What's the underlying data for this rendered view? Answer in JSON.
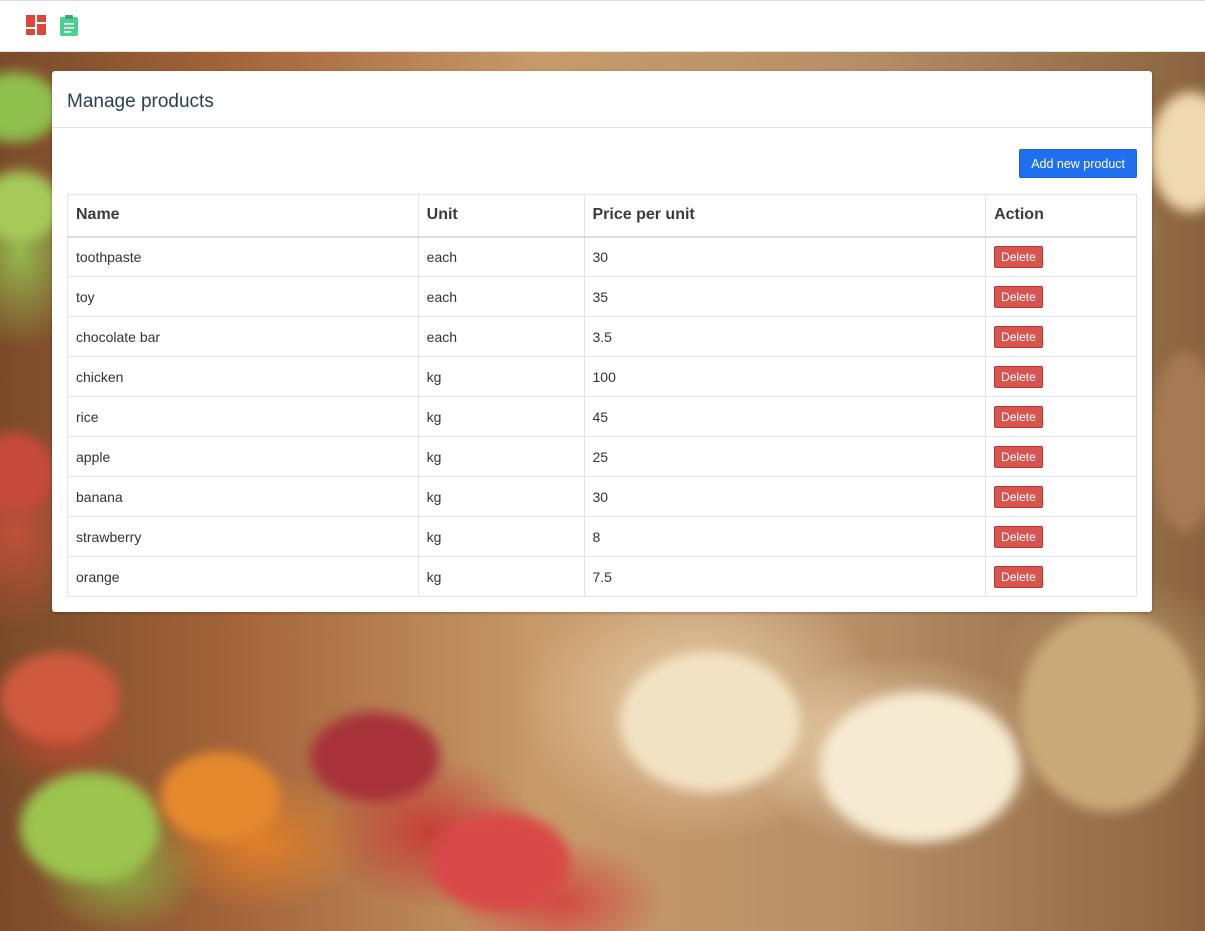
{
  "navbar": {
    "icons": [
      {
        "name": "dashboard-icon",
        "color": "#d9483b"
      },
      {
        "name": "clipboard-icon",
        "color": "#4cd08f"
      }
    ]
  },
  "page": {
    "title": "Manage products",
    "add_button_label": "Add new product"
  },
  "table": {
    "headers": [
      "Name",
      "Unit",
      "Price per unit",
      "Action"
    ],
    "rows": [
      {
        "name": "toothpaste",
        "unit": "each",
        "price": "30",
        "action": "Delete"
      },
      {
        "name": "toy",
        "unit": "each",
        "price": "35",
        "action": "Delete"
      },
      {
        "name": "chocolate bar",
        "unit": "each",
        "price": "3.5",
        "action": "Delete"
      },
      {
        "name": "chicken",
        "unit": "kg",
        "price": "100",
        "action": "Delete"
      },
      {
        "name": "rice",
        "unit": "kg",
        "price": "45",
        "action": "Delete"
      },
      {
        "name": "apple",
        "unit": "kg",
        "price": "25",
        "action": "Delete"
      },
      {
        "name": "banana",
        "unit": "kg",
        "price": "30",
        "action": "Delete"
      },
      {
        "name": "strawberry",
        "unit": "kg",
        "price": "8",
        "action": "Delete"
      },
      {
        "name": "orange",
        "unit": "kg",
        "price": "7.5",
        "action": "Delete"
      }
    ]
  },
  "colors": {
    "primary_button": "#1f6ff0",
    "danger_button": "#d9534f",
    "title_text": "#2a3f54"
  }
}
